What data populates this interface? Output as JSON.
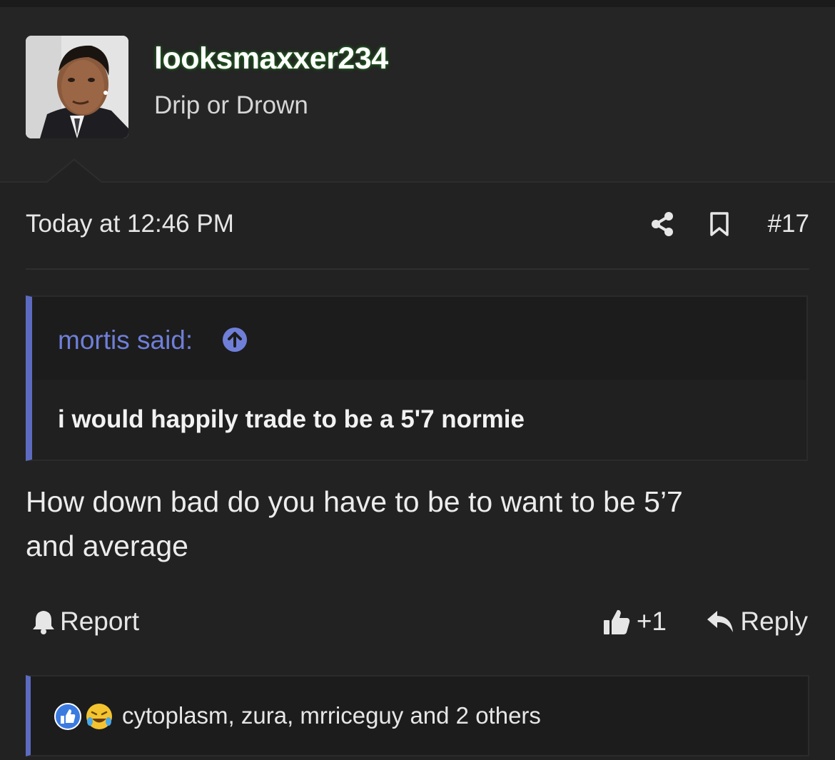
{
  "user": {
    "name": "looksmaxxer234",
    "title": "Drip or Drown",
    "name_glow_color": "#2e7d2e"
  },
  "post": {
    "timestamp": "Today at 12:46 PM",
    "number": "#17",
    "body_line1": "How down bad do you have to be to want to be 5’7",
    "body_line2": "and average",
    "icons": {
      "share": "share-icon",
      "bookmark": "bookmark-icon"
    }
  },
  "quote": {
    "author": "mortis said:",
    "text": "i would happily trade to be a 5'7 normie",
    "accent_color": "#5c6bc0",
    "icon": "arrow-up-circle-icon"
  },
  "actions": {
    "report": "Report",
    "like_count": "+1",
    "reply": "Reply"
  },
  "reactions": {
    "summary": "cytoplasm, zura, mrriceguy and 2 others",
    "icons": [
      "like-reaction-icon",
      "laugh-cry-reaction-icon"
    ]
  }
}
